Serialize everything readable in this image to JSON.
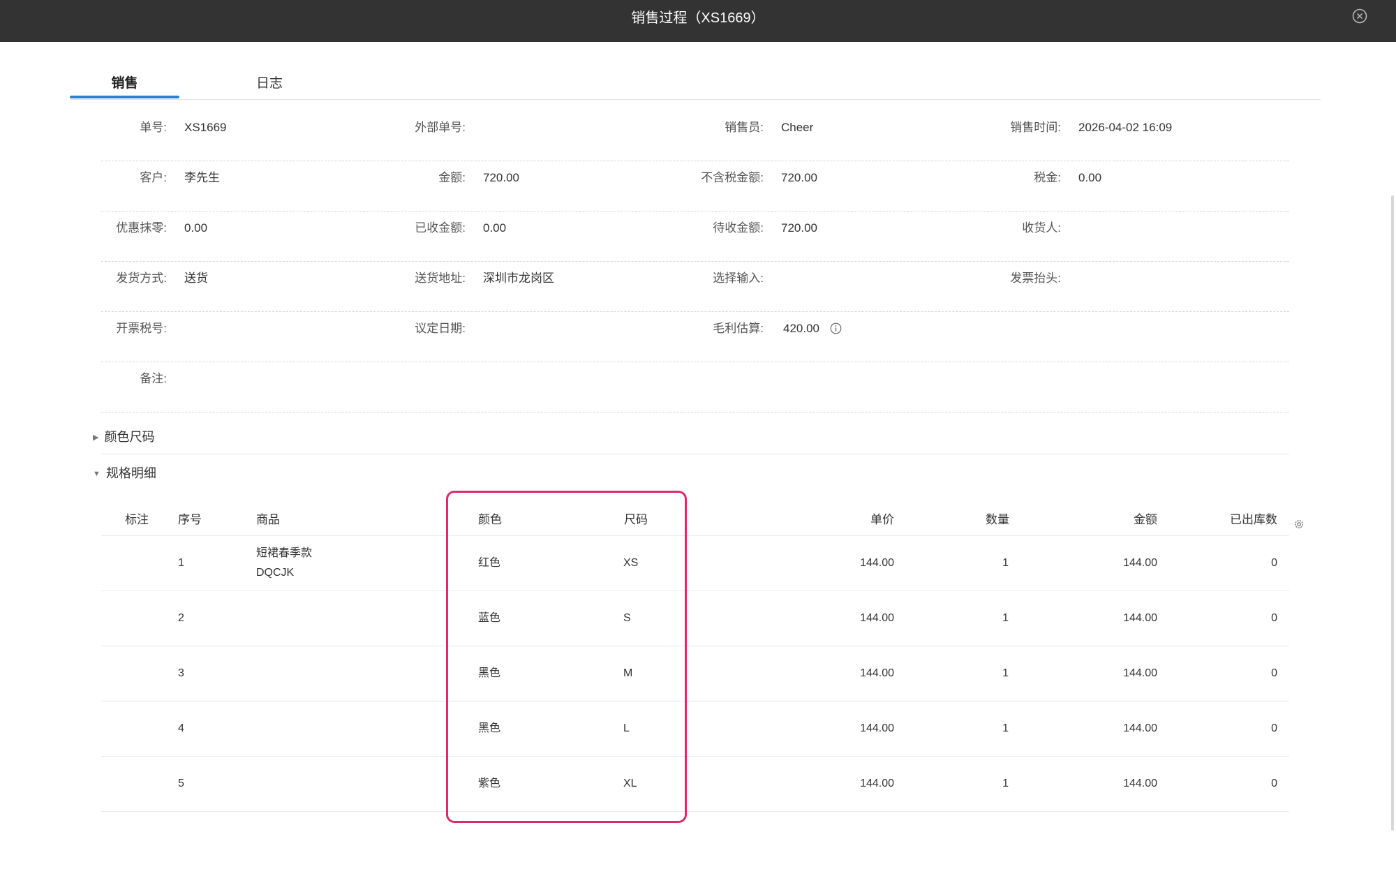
{
  "window": {
    "title": "销售过程（XS1669）",
    "close_icon": "close-circle-icon"
  },
  "tabs": [
    {
      "label": "销售",
      "active": true
    },
    {
      "label": "日志",
      "active": false
    }
  ],
  "info": {
    "order_no": {
      "label": "单号:",
      "value": "XS1669"
    },
    "external_no": {
      "label": "外部单号:",
      "value": ""
    },
    "salesperson": {
      "label": "销售员:",
      "value": "Cheer"
    },
    "sale_time": {
      "label": "销售时间:",
      "value": "2026-04-02 16:09"
    },
    "customer": {
      "label": "客户:",
      "value": "李先生"
    },
    "amount": {
      "label": "金额:",
      "value": "720.00"
    },
    "amount_ex_tax": {
      "label": "不含税金额:",
      "value": "720.00"
    },
    "tax": {
      "label": "税金:",
      "value": "0.00"
    },
    "discount": {
      "label": "优惠抹零:",
      "value": "0.00"
    },
    "received": {
      "label": "已收金额:",
      "value": "0.00"
    },
    "pending": {
      "label": "待收金额:",
      "value": "720.00"
    },
    "receiver": {
      "label": "收货人:",
      "value": ""
    },
    "ship_method": {
      "label": "发货方式:",
      "value": "送货"
    },
    "ship_address": {
      "label": "送货地址:",
      "value": "深圳市龙岗区"
    },
    "select_input": {
      "label": "选择输入:",
      "value": ""
    },
    "invoice_title": {
      "label": "发票抬头:",
      "value": ""
    },
    "tax_no": {
      "label": "开票税号:",
      "value": ""
    },
    "agreed_date": {
      "label": "议定日期:",
      "value": ""
    },
    "gross_profit": {
      "label": "毛利估算:",
      "value": "420.00"
    },
    "remark": {
      "label": "备注:",
      "value": ""
    }
  },
  "sections": {
    "color_size": {
      "label": "颜色尺码",
      "expanded": false
    },
    "spec_detail": {
      "label": "规格明细",
      "expanded": true
    }
  },
  "table": {
    "headers": {
      "mark": "标注",
      "seq": "序号",
      "product": "商品",
      "color": "颜色",
      "size": "尺码",
      "unit_price": "单价",
      "qty": "数量",
      "amount": "金额",
      "shipped": "已出库数"
    },
    "rows": [
      {
        "seq": "1",
        "product_name": "短裙春季款",
        "product_code": "DQCJK",
        "color": "红色",
        "size": "XS",
        "unit_price": "144.00",
        "qty": "1",
        "amount": "144.00",
        "shipped": "0"
      },
      {
        "seq": "2",
        "product_name": "",
        "product_code": "",
        "color": "蓝色",
        "size": "S",
        "unit_price": "144.00",
        "qty": "1",
        "amount": "144.00",
        "shipped": "0"
      },
      {
        "seq": "3",
        "product_name": "",
        "product_code": "",
        "color": "黑色",
        "size": "M",
        "unit_price": "144.00",
        "qty": "1",
        "amount": "144.00",
        "shipped": "0"
      },
      {
        "seq": "4",
        "product_name": "",
        "product_code": "",
        "color": "黑色",
        "size": "L",
        "unit_price": "144.00",
        "qty": "1",
        "amount": "144.00",
        "shipped": "0"
      },
      {
        "seq": "5",
        "product_name": "",
        "product_code": "",
        "color": "紫色",
        "size": "XL",
        "unit_price": "144.00",
        "qty": "1",
        "amount": "144.00",
        "shipped": "0"
      }
    ]
  },
  "colors": {
    "tab_accent": "#2d7fd6",
    "highlight": "#e0296c",
    "titlebar": "#333333"
  }
}
